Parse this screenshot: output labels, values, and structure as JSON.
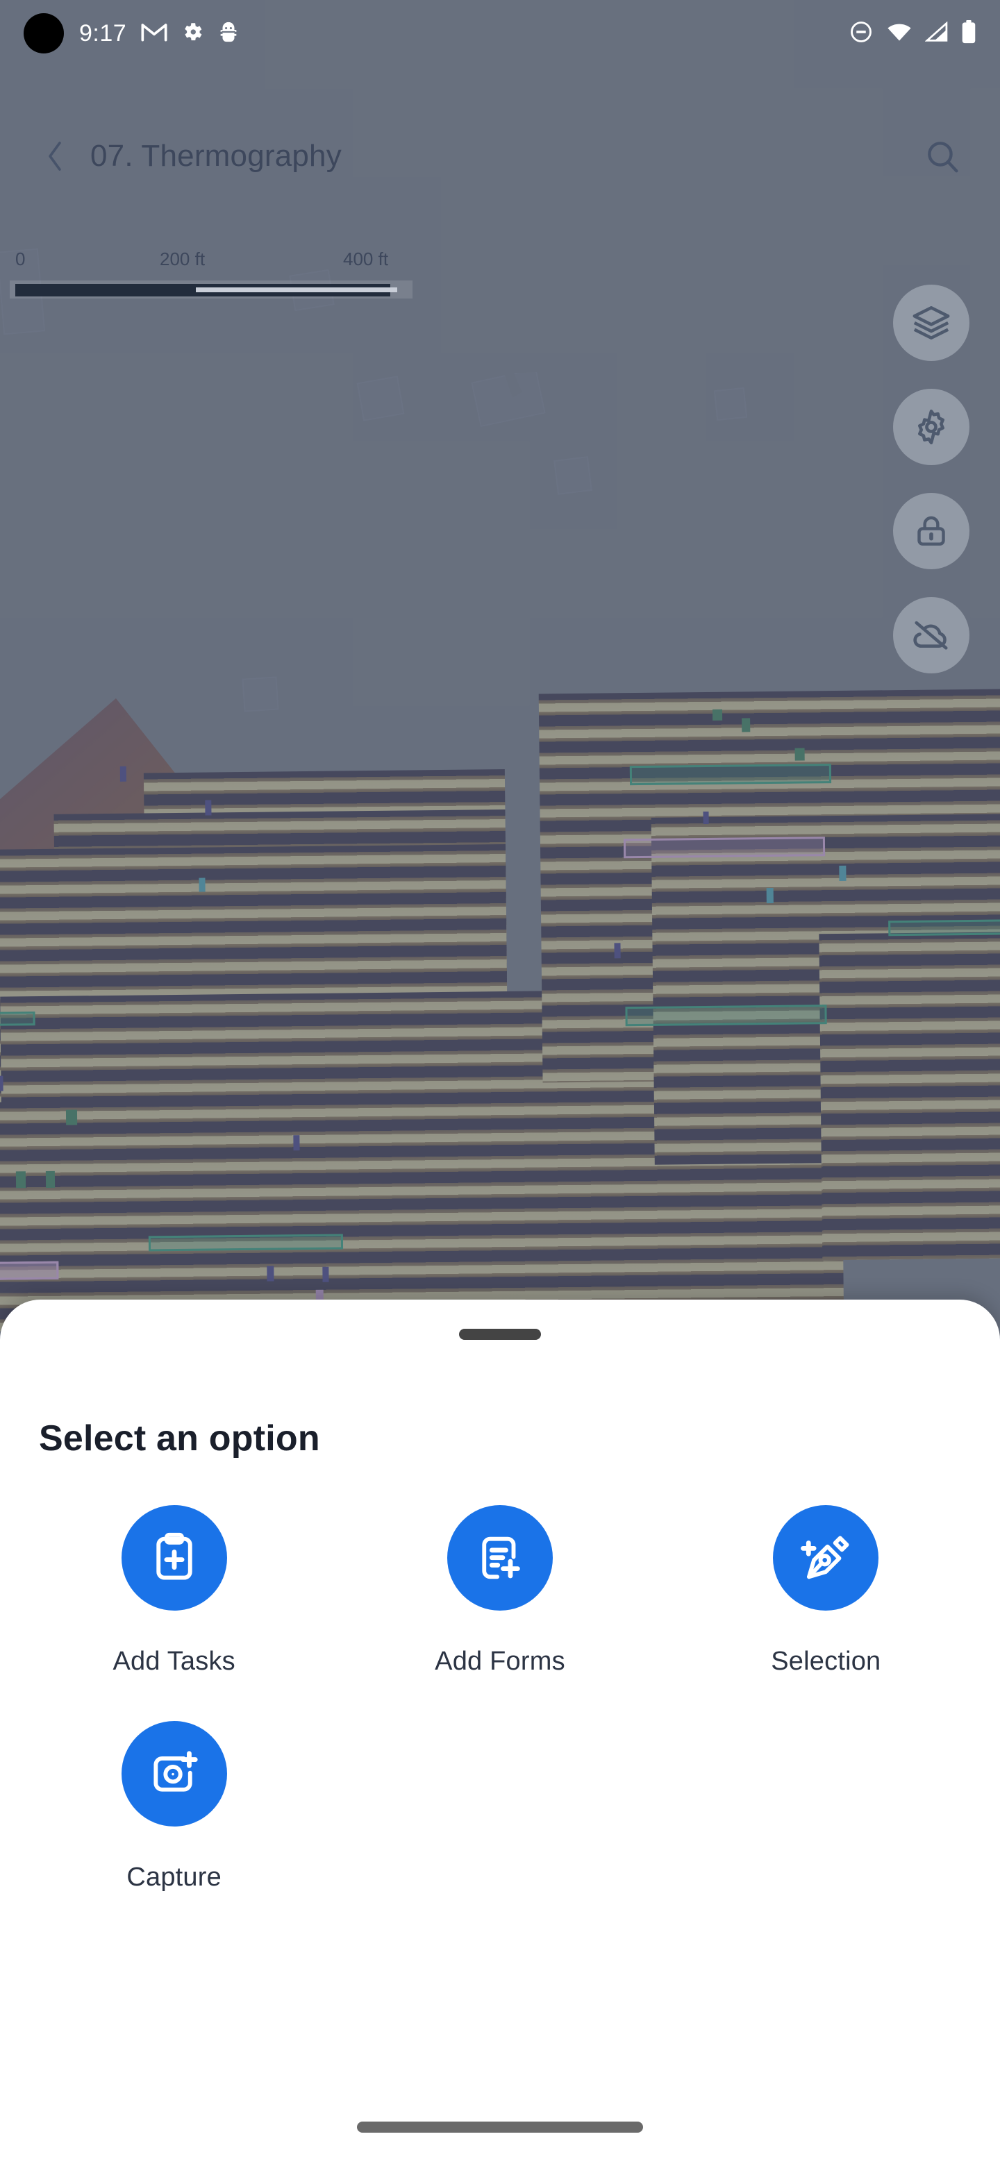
{
  "status_bar": {
    "time": "9:17",
    "left_icons": [
      "camera-punch-hole",
      "gmail-icon",
      "gear-icon",
      "android-bug-icon"
    ],
    "right_icons": [
      "do-not-disturb-icon",
      "wifi-icon",
      "cell-signal-icon",
      "battery-icon"
    ]
  },
  "app_bar": {
    "back_icon": "chevron-left-icon",
    "title": "07. Thermography",
    "search_icon": "search-icon"
  },
  "map": {
    "scale": {
      "zero": "0",
      "mid": "200 ft",
      "max": "400 ft"
    },
    "fabs": [
      {
        "name": "layers-icon",
        "label": "Layers"
      },
      {
        "name": "gear-icon",
        "label": "Settings"
      },
      {
        "name": "lock-icon",
        "label": "Lock"
      },
      {
        "name": "cloud-off-icon",
        "label": "Offline"
      }
    ],
    "layer_type": "thermal-orthomosaic",
    "accent_annotation_green": "#27a07a",
    "accent_annotation_pink": "#d8a9e0"
  },
  "bottom_sheet": {
    "handle": "drag-handle",
    "title": "Select an option",
    "accent_color": "#1a73e8",
    "options": [
      {
        "label": "Add Tasks",
        "icon": "clipboard-plus-icon"
      },
      {
        "label": "Add Forms",
        "icon": "document-plus-icon"
      },
      {
        "label": "Selection",
        "icon": "pen-nib-plus-icon"
      },
      {
        "label": "Capture",
        "icon": "camera-plus-icon"
      }
    ]
  },
  "navigation": {
    "home_indicator": "home-indicator-bar"
  }
}
